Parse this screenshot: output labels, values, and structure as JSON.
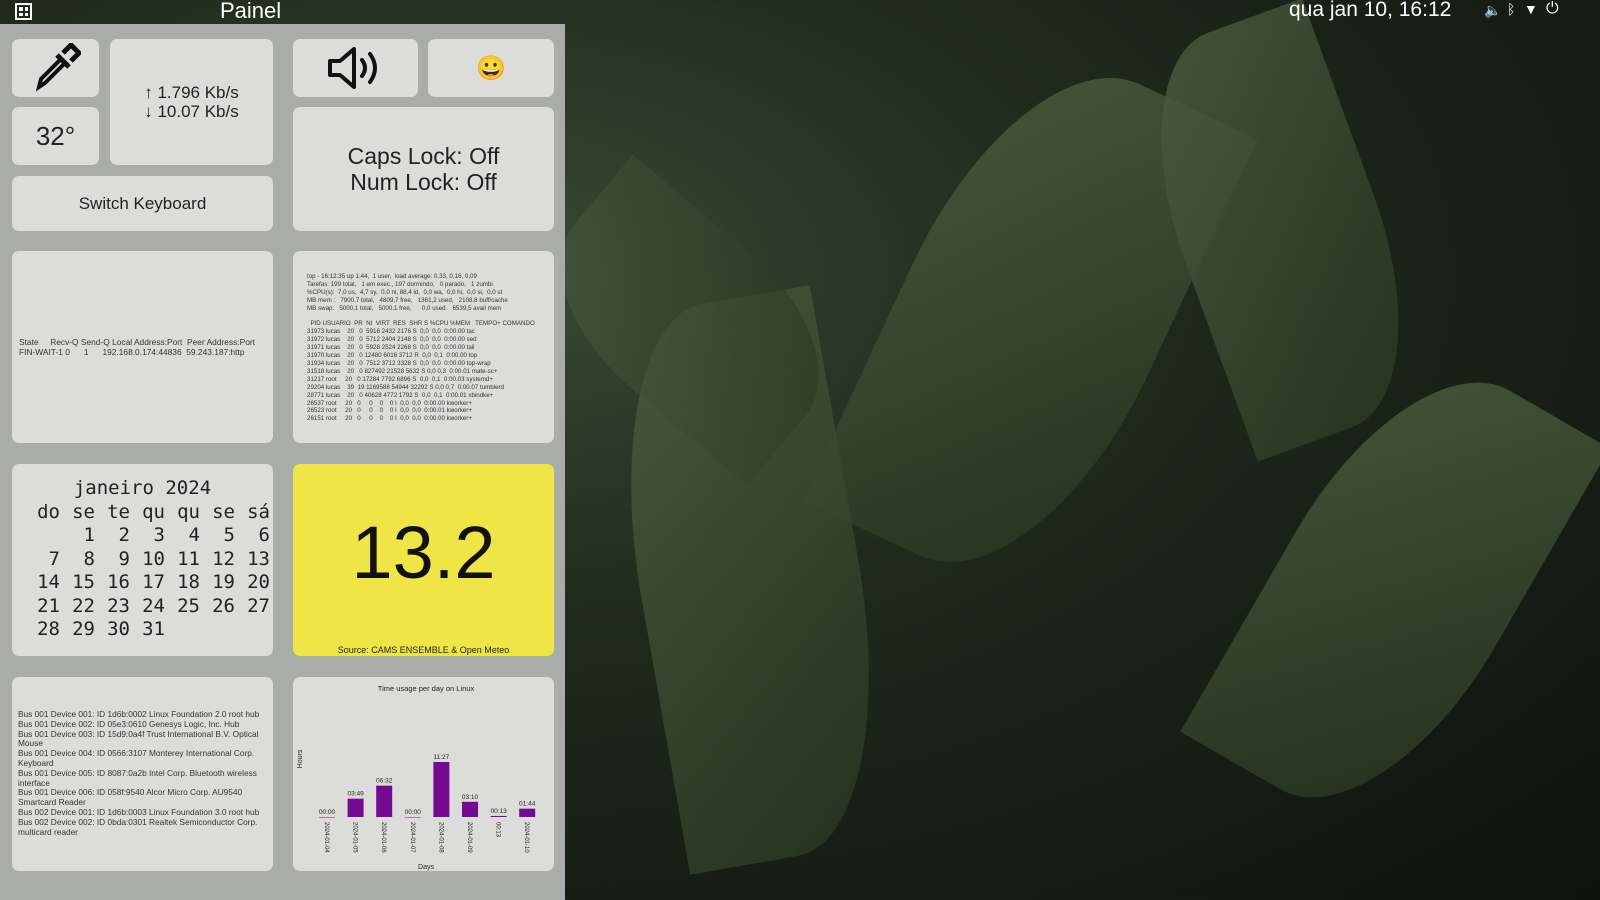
{
  "topbar": {
    "title": "Painel",
    "datetime": "qua jan 10, 16:12",
    "icons": [
      "grid-icon",
      "volume-icon",
      "bluetooth-icon",
      "wifi-icon",
      "power-icon"
    ]
  },
  "widgets": {
    "temperature": "32°",
    "net": {
      "up": "↑ 1.796 Kb/s",
      "down": "↓ 10.07 Kb/s"
    },
    "switch_keyboard": "Switch Keyboard",
    "locks": {
      "caps": "Caps Lock: Off",
      "num": "Num Lock: Off"
    },
    "emoji": "😀",
    "netstat": [
      "State     Recv-Q Send-Q Local Address:Port  Peer Address:Port",
      "FIN-WAIT-1 0      1      192.168.0.174:44836  59.243.187:http"
    ],
    "top": [
      "top - 16:12:35 up 1:44,  1 user,  load average: 0,33, 0,16, 0,09",
      "Tarefas: 199 total,   1 em exec., 197 dormindo,   0 parado,   1 zumbi",
      "%CPU(s):  7,0 us,  4,7 sy,  0,0 ni, 88,4 id,  0,0 wa,  0,0 hi,  0,0 si,  0,0 st",
      "MB mem :   7900,7 total,   4809,7 free,   1361,2 used,   2108,8 buff/cache",
      "MB swap:   5000,1 total,   5000,1 free,      0,0 used.   6539,5 avail mem",
      "",
      "  PID USUARIO  PR  NI  VIRT  RES  SHR S %CPU %MEM   TEMPO+ COMANDO",
      "31973 lucas    20   0  5916 2432 2176 S  0,0  0,0  0:00.00 tac",
      "31972 lucas    20   0  5712 2404 2148 S  0,0  0,0  0:00.00 sed",
      "31971 lucas    20   0  5928 2524 2268 S  0,0  0,0  0:00.00 tail",
      "31970 lucas    20   0 12480 6016 3712 R  0,0  0,1  0:00.00 top",
      "31934 lucas    20   0  7512 3712 3328 S  0,0  0,0  0:00.00 top-wrap",
      "31518 lucas    20   0 827492 21528 5632 S 0,0 0,3  0:00.01 mate-sc+",
      "31217 root     20   0 17284 7792 6896 S  0,0  0,1  0:00.03 systemd+",
      "29204 lucas    39  19 1169588 54944 32292 S 0,0 0,7  0:00.07 tumblerd",
      "28771 lucas    20   0 40628 4772 1792 S  0,0  0,1  0:00.01 xbindke+",
      "26537 root     20   0     0    0    0 I  0,0  0,0  0:00.00 kworker+",
      "26523 root     20   0     0    0    0 I  0,0  0,0  0:00.01 kworker+",
      "26151 root     20   0     0    0    0 I  0,0  0,0  0:00.00 kworker+"
    ],
    "calendar": {
      "title": "janeiro 2024",
      "weekdays": [
        "do",
        "se",
        "te",
        "qu",
        "qu",
        "se",
        "sá"
      ],
      "first_weekday": 1,
      "days": 31
    },
    "air_quality": {
      "value": "13.2",
      "source": "Source: CAMS ENSEMBLE & Open Meteo",
      "color": "#efe646"
    },
    "lsusb": [
      "Bus 001 Device 001: ID 1d6b:0002 Linux Foundation 2.0 root hub",
      "Bus 001 Device 002: ID 05e3:0610 Genesys Logic, Inc. Hub",
      "Bus 001 Device 003: ID 15d9:0a4f Trust International B.V. Optical Mouse",
      "Bus 001 Device 004: ID 0566:3107 Monterey International Corp. Keyboard",
      "Bus 001 Device 005: ID 8087:0a2b Intel Corp. Bluetooth wireless interface",
      "Bus 001 Device 006: ID 058f:9540 Alcor Micro Corp. AU9540 Smartcard Reader",
      "Bus 002 Device 001: ID 1d6b:0003 Linux Foundation 3.0 root hub",
      "Bus 002 Device 002: ID 0bda:0301 Realtek Semiconductor Corp. multicard reader"
    ]
  },
  "chart_data": {
    "type": "bar",
    "title": "Time usage per day on Linux",
    "xlabel": "Days",
    "ylabel": "Hours",
    "categories": [
      "2024-01-04",
      "2024-01-05",
      "2024-01-06",
      "2024-01-07",
      "2024-01-08",
      "2024-01-09",
      "00:13",
      "2024-01-10"
    ],
    "values": [
      0,
      3.817,
      6.533,
      0,
      11.45,
      3.167,
      0.217,
      1.733
    ],
    "data_labels": [
      "00:00",
      "03:49",
      "06:32",
      "00:00",
      "11:27",
      "03:10",
      "00:13",
      "01:44"
    ],
    "color": "#750a93"
  }
}
